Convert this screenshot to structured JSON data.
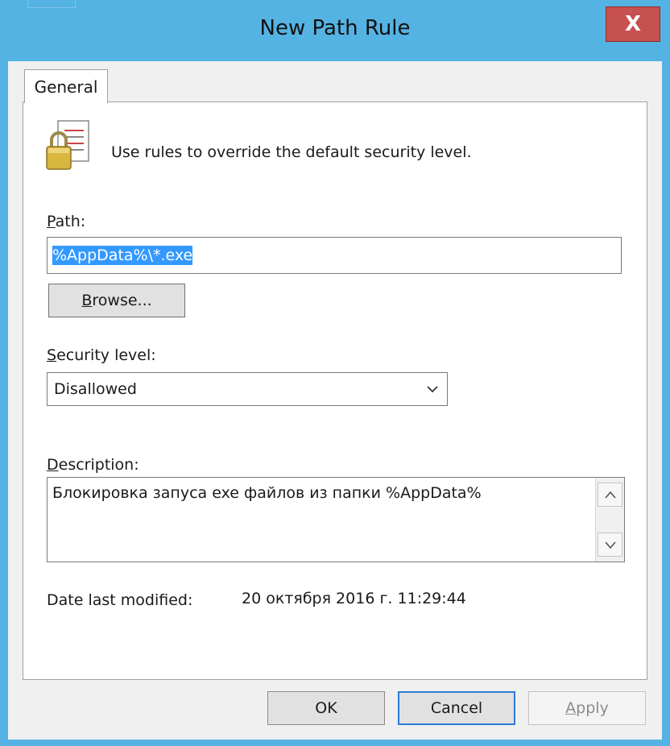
{
  "window": {
    "title": "New Path Rule",
    "close_glyph": "X"
  },
  "tabs": [
    {
      "label": "General",
      "selected": true
    }
  ],
  "intro": {
    "icon": "lock-document-icon",
    "text": "Use rules to override the default security level."
  },
  "path": {
    "label_accel": "P",
    "label_rest": "ath:",
    "value": "%AppData%\\*.exe"
  },
  "browse": {
    "label_accel": "B",
    "label_rest": "rowse..."
  },
  "security": {
    "label_accel": "S",
    "label_rest": "ecurity level:",
    "selected": "Disallowed"
  },
  "description": {
    "label_accel": "D",
    "label_rest": "escription:",
    "value": "Блокировка запуса exe файлов из папки %AppData%"
  },
  "date_modified": {
    "label": "Date last modified:",
    "value": "20 октября 2016 г.  11:29:44"
  },
  "buttons": {
    "ok": "OK",
    "cancel": "Cancel",
    "apply_accel": "A",
    "apply_rest": "pply"
  },
  "colors": {
    "frame": "#55b3e3",
    "close": "#c75050",
    "selection": "#3399ff",
    "focus_border": "#2b7cd3"
  }
}
